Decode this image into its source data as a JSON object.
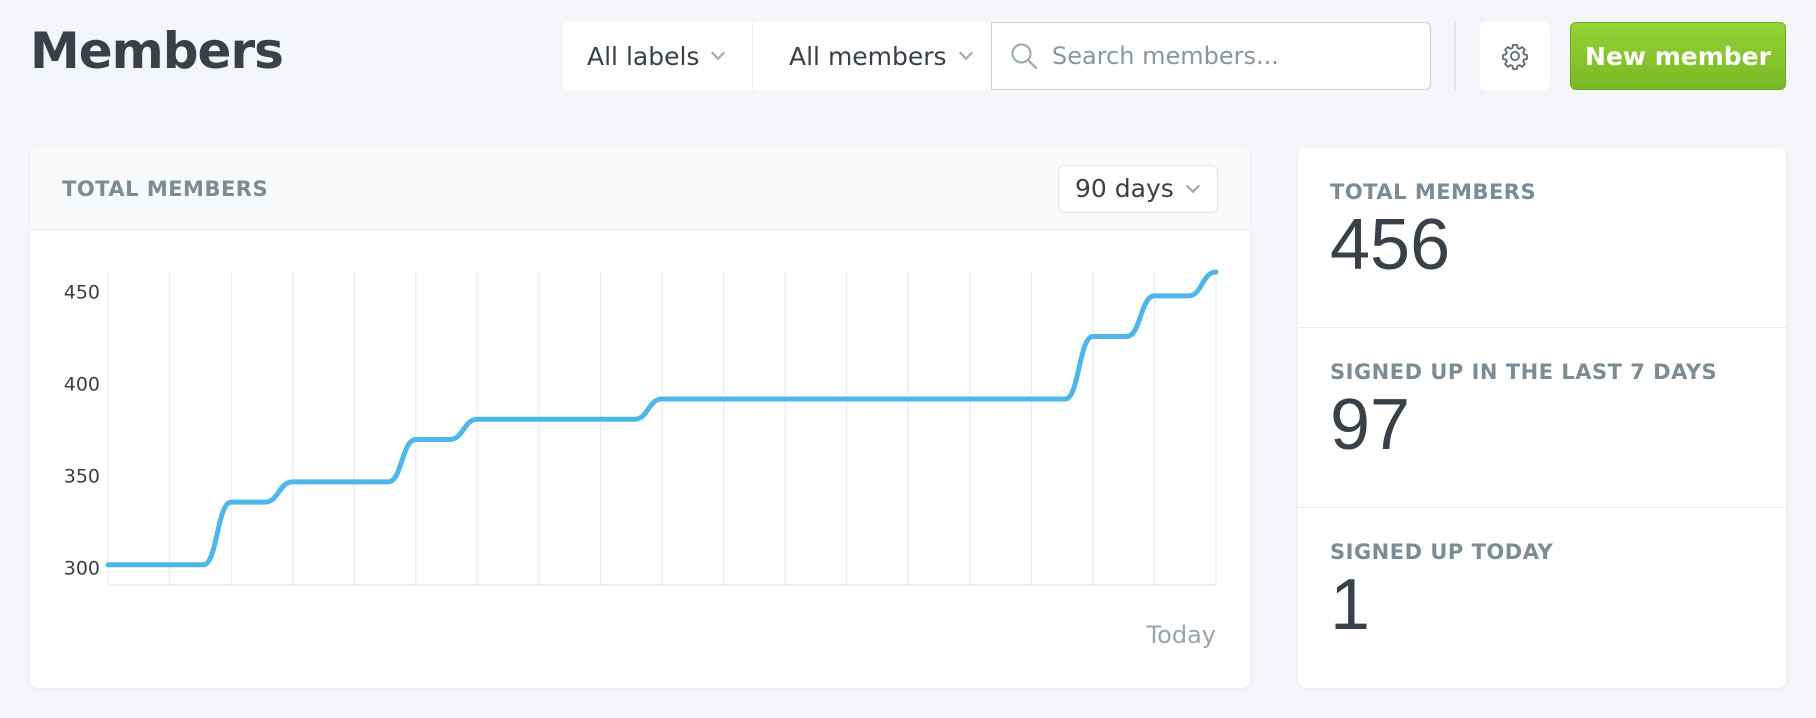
{
  "header": {
    "title": "Members",
    "labels_filter": "All labels",
    "members_filter": "All members",
    "search_placeholder": "Search members...",
    "new_member_label": "New member"
  },
  "chart_card": {
    "title": "TOTAL MEMBERS",
    "range": "90 days"
  },
  "stats": [
    {
      "label": "TOTAL MEMBERS",
      "value": "456"
    },
    {
      "label": "SIGNED UP IN THE LAST 7 DAYS",
      "value": "97"
    },
    {
      "label": "SIGNED UP TODAY",
      "value": "1"
    }
  ],
  "colors": {
    "line": "#4fb6ea",
    "accent": "#8bc93b",
    "grid": "#e3edf4"
  },
  "chart_data": {
    "type": "line",
    "categories": [
      "",
      "",
      "",
      "",
      "",
      "",
      "",
      "",
      "",
      "",
      "",
      "",
      "",
      "",
      "",
      "",
      "",
      ""
    ],
    "xlabel": "",
    "ylabel": "",
    "x_end_label": "Today",
    "yticks": [
      300,
      350,
      400,
      450
    ],
    "ylim": [
      290,
      460
    ],
    "series": [
      {
        "values": [
          301,
          301,
          335,
          346,
          346,
          369,
          380,
          380,
          380,
          391,
          391,
          391,
          391,
          391,
          391,
          391,
          425,
          447,
          460
        ]
      }
    ]
  }
}
